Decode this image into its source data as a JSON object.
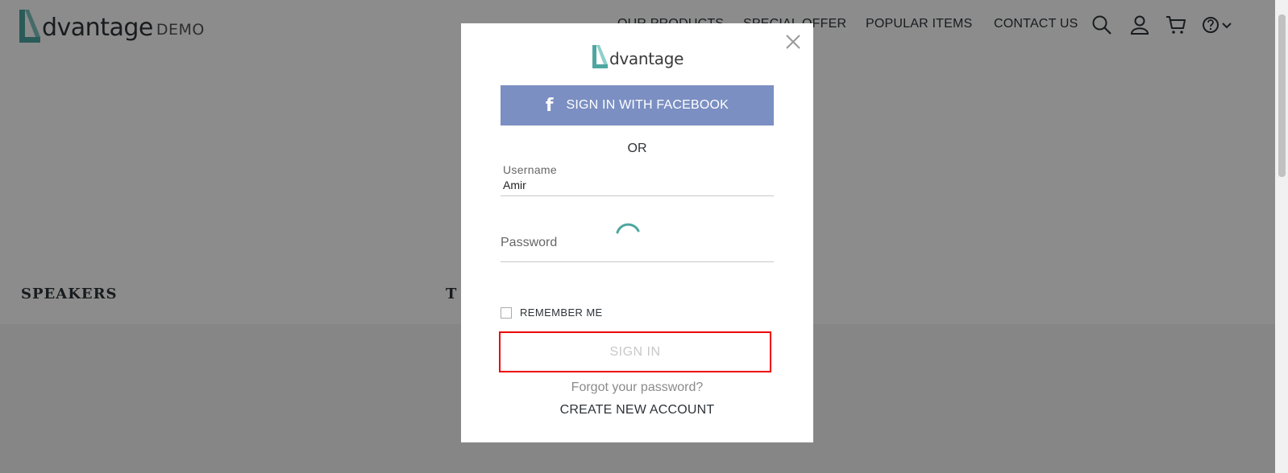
{
  "header": {
    "logo_text": "dvantage",
    "logo_suffix": "DEMO",
    "nav": [
      "OUR PRODUCTS",
      "SPECIAL OFFER",
      "POPULAR ITEMS",
      "CONTACT US"
    ],
    "icons": [
      "search-icon",
      "user-icon",
      "cart-icon",
      "help-icon",
      "chevron-down-icon"
    ]
  },
  "categories": [
    "SPEAKERS",
    "T"
  ],
  "modal": {
    "logo_text": "dvantage",
    "facebook_label": "SIGN IN WITH FACEBOOK",
    "or_label": "OR",
    "username_label": "Username",
    "username_value": "Amir",
    "password_label": "Password",
    "remember_label": "REMEMBER ME",
    "signin_label": "SIGN IN",
    "forgot_label": "Forgot your password?",
    "create_label": "CREATE NEW ACCOUNT"
  },
  "colors": {
    "brand_teal": "#4ea6a0",
    "facebook_blue": "#7b8fc2",
    "highlight_red": "#ee0000"
  }
}
